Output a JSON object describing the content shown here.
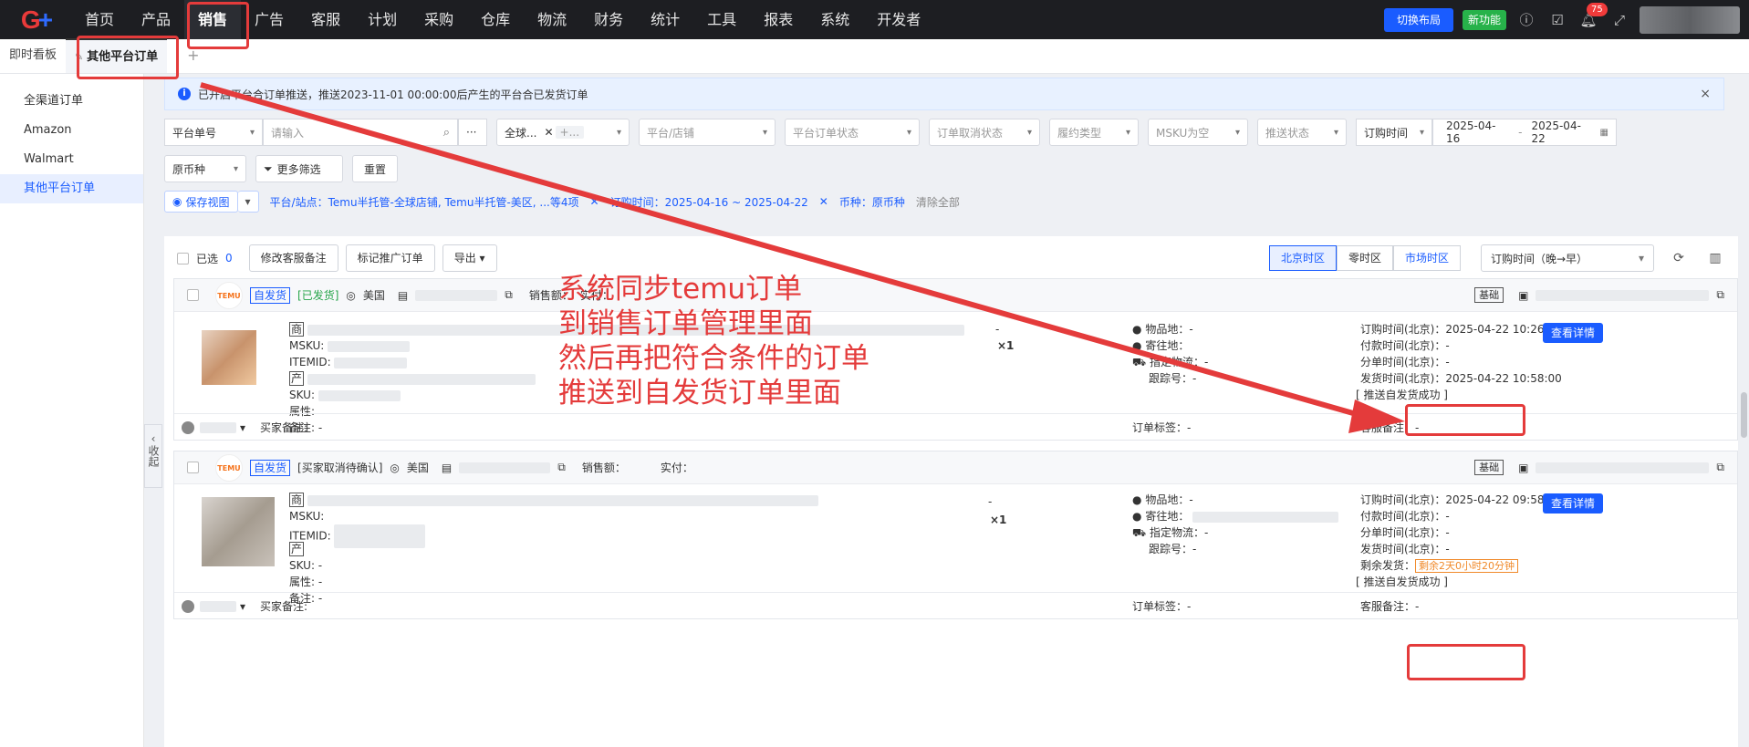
{
  "topnav": {
    "logo": "G",
    "items": [
      "首页",
      "产品",
      "销售",
      "广告",
      "客服",
      "计划",
      "采购",
      "仓库",
      "物流",
      "财务",
      "统计",
      "工具",
      "报表",
      "系统",
      "开发者"
    ],
    "active_index": 2,
    "switch_layout": "切换布局",
    "new_feature": "新功能",
    "notify_count": "75"
  },
  "tabs": {
    "items": [
      "即时看板",
      "其他平台订单"
    ],
    "add": "+"
  },
  "sidebar": {
    "items": [
      "全渠道订单",
      "Amazon",
      "Walmart",
      "其他平台订单"
    ],
    "collapse": "收起"
  },
  "alert": {
    "text": "已开启平台合订单推送，推送2023-11-01 00:00:00后产生的平台合已发货订单",
    "close": "×"
  },
  "filters": {
    "search_type": "平台单号",
    "search_placeholder": "请输入",
    "region": "全球...",
    "region_more": "+...",
    "platform_store": "平台/店铺",
    "platform_order_status": "平台订单状态",
    "cancel_status": "订单取消状态",
    "fulfill_type": "履约类型",
    "msku_empty": "MSKU为空",
    "push_status": "推送状态",
    "time_type": "订购时间",
    "date_start": "2025-04-16",
    "date_sep": "-",
    "date_end": "2025-04-22",
    "currency": "原币种",
    "more_filter": "更多筛选",
    "reset": "重置"
  },
  "tagrow": {
    "save_view": "保存视图",
    "tag1": "平台/站点：Temu半托管-全球店铺, Temu半托管-美区, ...等4项",
    "tag2": "订购时间：2025-04-16 ~ 2025-04-22",
    "tag3": "币种：原币种",
    "clear_all": "清除全部"
  },
  "toolbar": {
    "selected_label": "已选",
    "selected_count": "0",
    "edit_remark": "修改客服备注",
    "mark_promo": "标记推广订单",
    "export": "导出",
    "tz_beijing": "北京时区",
    "tz_zero": "零时区",
    "tz_market": "市场时区",
    "sort": "订购时间（晚→早）"
  },
  "orders": [
    {
      "logo": "TEMU",
      "ship_type": "自发货",
      "status": "[已发货]",
      "country": "美国",
      "sales_label": "销售额：",
      "actual_label": "实付：",
      "basic": "基础",
      "msku": "MSKU:",
      "itemid": "ITEMID:",
      "sku": "SKU:",
      "attr": "属性:",
      "remark": "备注: -",
      "qty": "×1",
      "dash": "-",
      "origin": "物品地：-",
      "deliver": "寄往地：",
      "logistics": "指定物流：-",
      "tracking": "跟踪号：-",
      "t_order": "订购时间(北京)：2025-04-22 10:26:56",
      "t_pay": "付款时间(北京)：-",
      "t_split": "分单时间(北京)：-",
      "t_ship": "发货时间(北京)：2025-04-22 10:58:00",
      "push": "[ 推送自发货成功 ]",
      "detail": "查看详情",
      "buyer_remark": "买家备注:",
      "order_tag": "订单标签：-",
      "cs_remark": "客服备注：-"
    },
    {
      "logo": "TEMU",
      "ship_type": "自发货",
      "status": "[买家取消待确认]",
      "country": "美国",
      "sales_label": "销售额：",
      "actual_label": "实付：",
      "basic": "基础",
      "msku": "MSKU:",
      "itemid": "ITEMID:",
      "sku": "SKU: -",
      "attr": "属性: -",
      "remark": "备注: -",
      "qty": "×1",
      "dash": "-",
      "origin": "物品地：-",
      "deliver": "寄往地：",
      "logistics": "指定物流：-",
      "tracking": "跟踪号：-",
      "t_order": "订购时间(北京)：2025-04-22 09:58:10",
      "t_pay": "付款时间(北京)：-",
      "t_split": "分单时间(北京)：-",
      "t_ship": "发货时间(北京)：-",
      "countdown_label": "剩余发货：",
      "countdown": "剩余2天0小时20分钟",
      "push": "[ 推送自发货成功 ]",
      "detail": "查看详情",
      "buyer_remark": "买家备注:",
      "order_tag": "订单标签：-",
      "cs_remark": "客服备注：-"
    }
  ],
  "annotation": {
    "lines": [
      "系统同步temu订单",
      "到销售订单管理里面",
      "然后再把符合条件的订单",
      "推送到自发货订单里面"
    ]
  },
  "colors": {
    "accent": "#1a5cff",
    "annotation": "#e43b3b",
    "nav_bg": "#1d1e22"
  }
}
